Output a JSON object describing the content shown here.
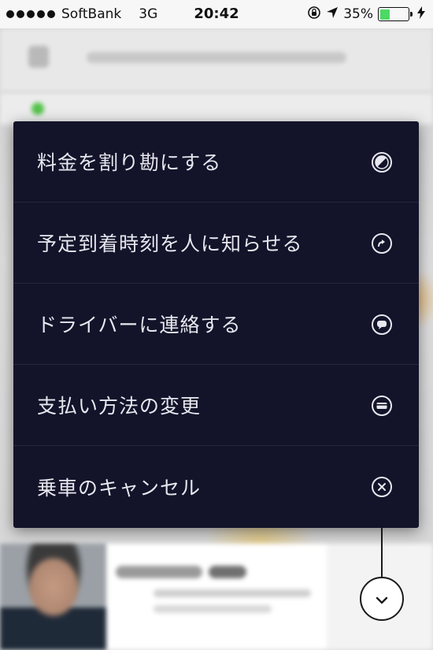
{
  "status_bar": {
    "carrier": "SoftBank",
    "network": "3G",
    "time": "20:42",
    "battery_percent": "35%",
    "battery_level": 0.35,
    "icons": [
      "rotation-lock-icon",
      "location-arrow-icon",
      "battery-icon",
      "charging-bolt-icon"
    ]
  },
  "menu": {
    "items": [
      {
        "label": "料金を割り勘にする",
        "icon": "split-fare-icon"
      },
      {
        "label": "予定到着時刻を人に知らせる",
        "icon": "share-eta-icon"
      },
      {
        "label": "ドライバーに連絡する",
        "icon": "message-bubble-icon"
      },
      {
        "label": "支払い方法の変更",
        "icon": "credit-card-icon"
      },
      {
        "label": "乗車のキャンセル",
        "icon": "cancel-x-icon"
      }
    ]
  },
  "collapse_button": {
    "icon": "chevron-down-icon"
  },
  "colors": {
    "menu_background": "#13132a",
    "menu_text": "#e7e7ef",
    "battery_fill": "#4cd964"
  }
}
